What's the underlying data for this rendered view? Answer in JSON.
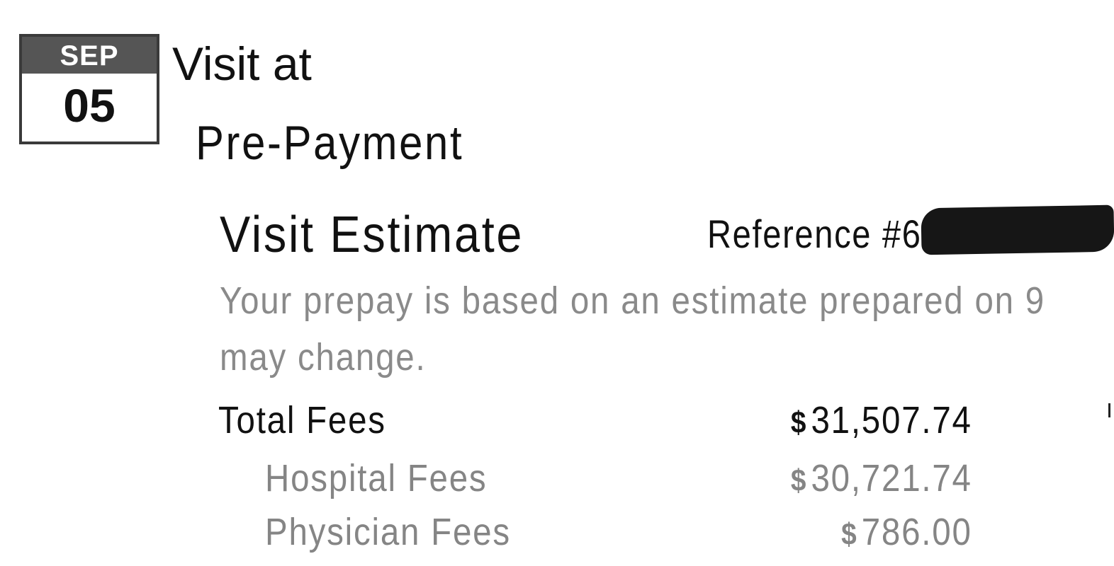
{
  "visit": {
    "date": {
      "month": "SEP",
      "day": "05"
    },
    "title": "Visit at",
    "status": "Pre-Payment"
  },
  "estimate": {
    "title": "Visit Estimate",
    "reference_label": "Reference #",
    "reference_visible": "6",
    "description": "Your prepay is based on an estimate prepared on 9",
    "description_line2": "may change."
  },
  "fees": {
    "currency_symbol": "$",
    "total": {
      "label": "Total Fees",
      "amount": "31,507.74"
    },
    "items": [
      {
        "label": "Hospital Fees",
        "amount": "30,721.74"
      },
      {
        "label": "Physician Fees",
        "amount": "786.00"
      }
    ]
  },
  "colors": {
    "primary_text": "#111111",
    "secondary_text": "#858585",
    "badge_header": "#555555"
  }
}
